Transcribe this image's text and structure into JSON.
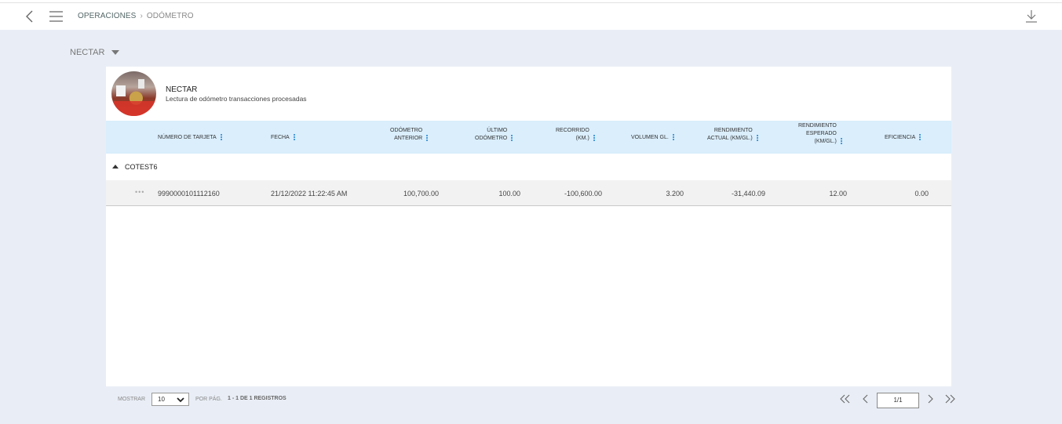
{
  "breadcrumb": {
    "section": "OPERACIONES",
    "separator": "›",
    "current": "ODÓMETRO"
  },
  "company_selector": {
    "value": "NECTAR"
  },
  "panel": {
    "title": "NECTAR",
    "subtitle": "Lectura de odómetro transacciones procesadas"
  },
  "table": {
    "headers": [
      {
        "line1": "NÚMERO DE TARJETA",
        "line2": "",
        "line3": ""
      },
      {
        "line1": "FECHA",
        "line2": "",
        "line3": ""
      },
      {
        "line1": "ODÓMETRO",
        "line2": "ANTERIOR",
        "line3": ""
      },
      {
        "line1": "ÚLTIMO",
        "line2": "ODÓMETRO",
        "line3": ""
      },
      {
        "line1": "RECORRIDO",
        "line2": "(KM.)",
        "line3": ""
      },
      {
        "line1": "VOLUMEN GL.",
        "line2": "",
        "line3": ""
      },
      {
        "line1": "RENDIMIENTO",
        "line2": "ACTUAL (KM/GL.)",
        "line3": ""
      },
      {
        "line1": "RENDIMIENTO",
        "line2": "ESPERADO",
        "line3": "(KM/GL.)"
      },
      {
        "line1": "EFICIENCIA",
        "line2": "",
        "line3": ""
      }
    ],
    "group": {
      "label": "COTEST6"
    },
    "rows": [
      {
        "actions": "•••",
        "tarjeta": "9990000101112160",
        "fecha": "21/12/2022 11:22:45 AM",
        "odometro_anterior": "100,700.00",
        "ultimo_odometro": "100.00",
        "recorrido": "-100,600.00",
        "volumen": "3.200",
        "rendimiento_actual": "-31,440.09",
        "rendimiento_esperado": "12.00",
        "eficiencia": "0.00"
      }
    ]
  },
  "footer": {
    "show_label": "MOSTRAR",
    "page_size": "10",
    "per_page_label": "POR PÁG.",
    "records": "1 - 1 DE 1 REGISTROS",
    "page_indicator": "1/1"
  },
  "colors": {
    "header_bg": "#daeefc",
    "background": "#e9eef6",
    "accent": "#1a7fd0"
  },
  "icons": [
    "back-icon",
    "menu-icon",
    "download-icon",
    "caret-down-icon",
    "kebab-icon",
    "first-page-icon",
    "prev-page-icon",
    "next-page-icon",
    "last-page-icon",
    "chevron-down-icon"
  ]
}
